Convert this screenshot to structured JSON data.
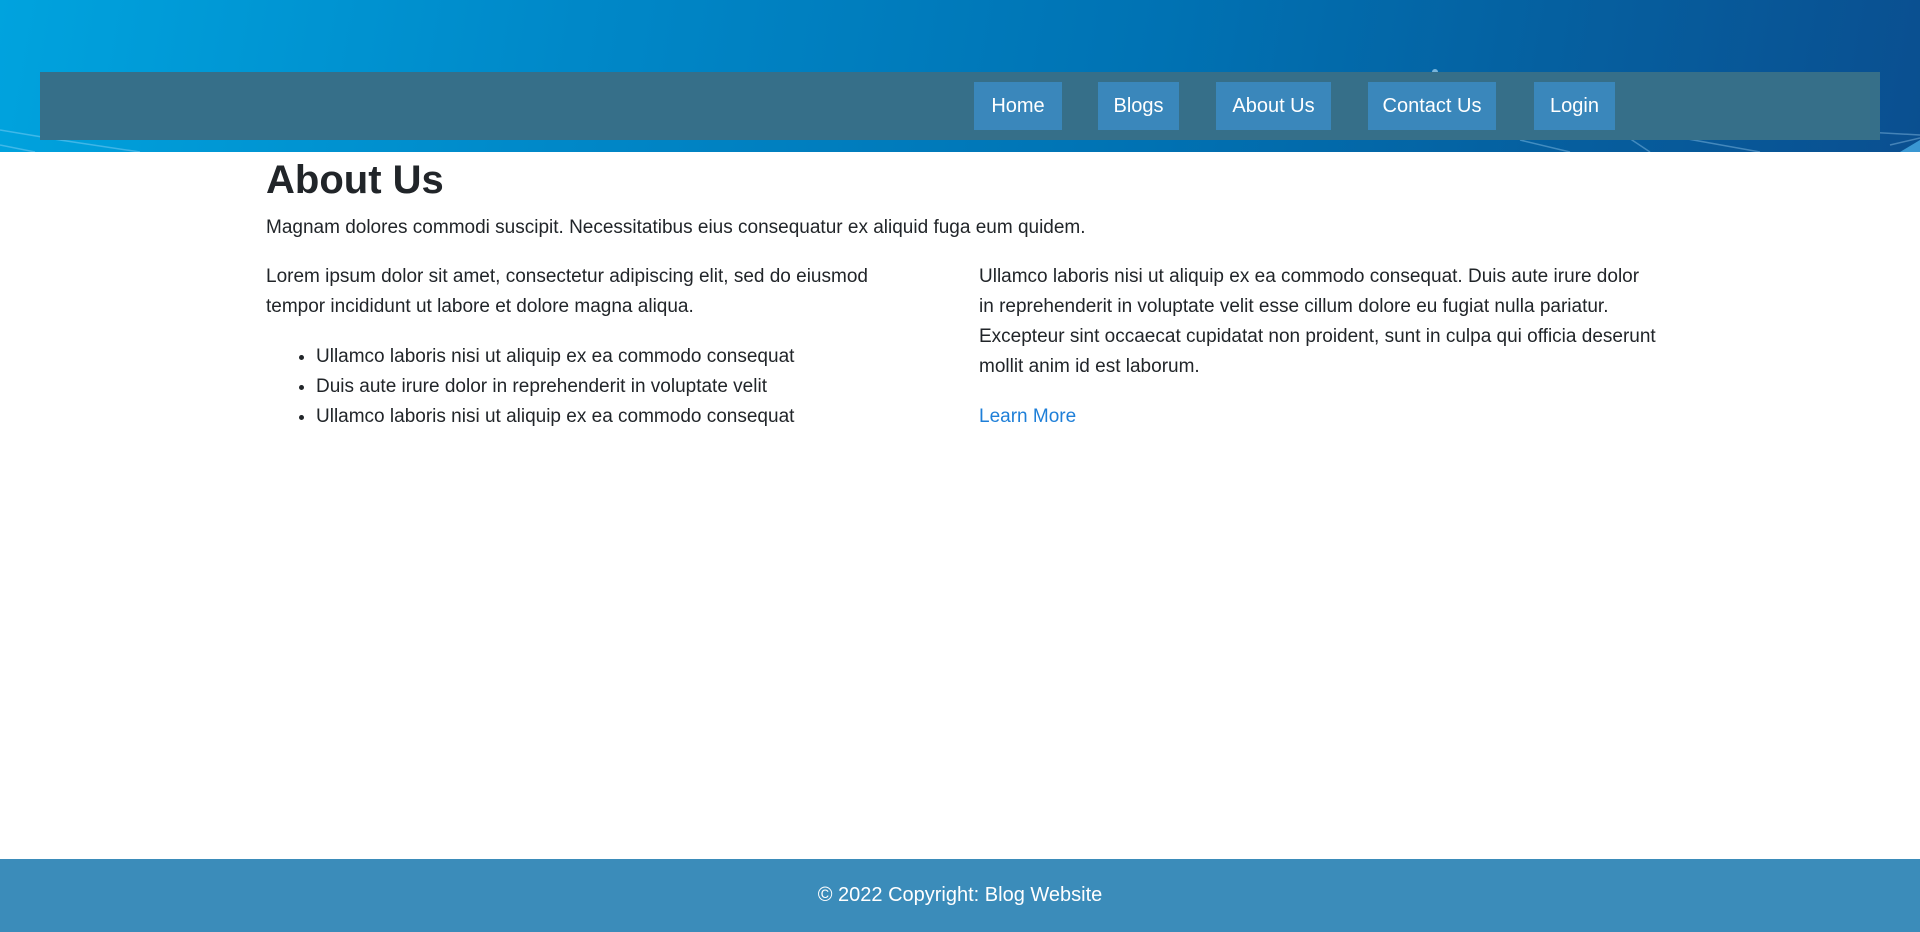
{
  "nav": {
    "items": [
      {
        "label": "Home"
      },
      {
        "label": "Blogs"
      },
      {
        "label": "About Us"
      },
      {
        "label": "Contact Us"
      },
      {
        "label": "Login"
      }
    ]
  },
  "main": {
    "title": "About Us",
    "lead": "Magnam dolores commodi suscipit. Necessitatibus eius consequatur ex aliquid fuga eum quidem.",
    "left_paragraph": "Lorem ipsum dolor sit amet, consectetur adipiscing elit, sed do eiusmod tempor incididunt ut labore et dolore magna aliqua.",
    "list": [
      "Ullamco laboris nisi ut aliquip ex ea commodo consequat",
      "Duis aute irure dolor in reprehenderit in voluptate velit",
      "Ullamco laboris nisi ut aliquip ex ea commodo consequat"
    ],
    "right_paragraph": "Ullamco laboris nisi ut aliquip ex ea commodo consequat. Duis aute irure dolor in reprehenderit in voluptate velit esse cillum dolore eu fugiat nulla pariatur. Excepteur sint occaecat cupidatat non proident, sunt in culpa qui officia deserunt mollit anim id est laborum.",
    "learn_more": "Learn More"
  },
  "footer": {
    "text": "© 2022 Copyright: Blog Website"
  },
  "colors": {
    "navbar": "#366f89",
    "nav_button": "#3a87bb",
    "footer": "#3b8cba",
    "link": "#1e7fd8"
  }
}
